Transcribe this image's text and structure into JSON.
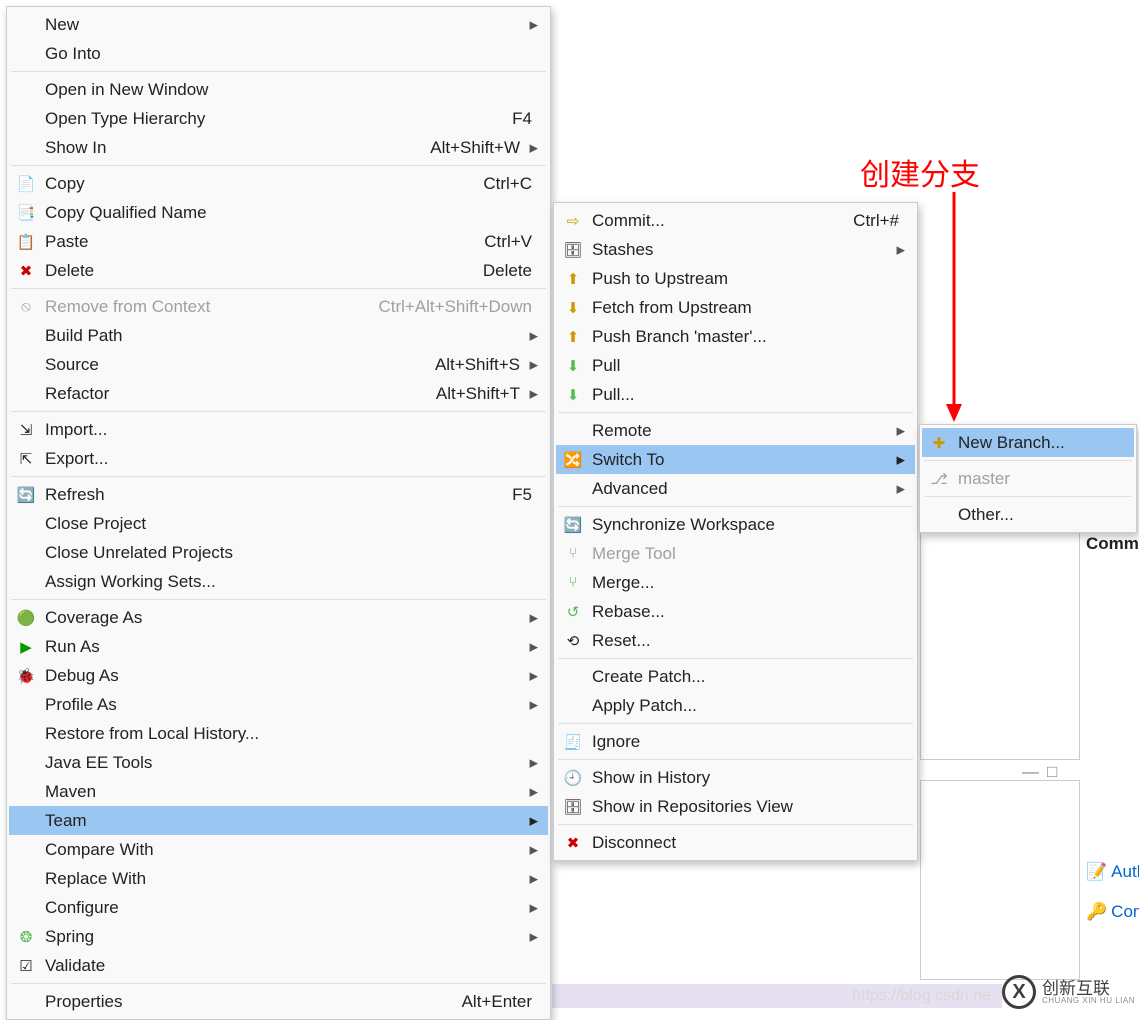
{
  "annotation": {
    "text": "创建分支"
  },
  "menu1": {
    "groups": [
      [
        {
          "icon": "",
          "label": "New",
          "accel": "",
          "arrow": true
        },
        {
          "icon": "",
          "label": "Go Into",
          "accel": "",
          "arrow": false
        }
      ],
      [
        {
          "icon": "",
          "label": "Open in New Window",
          "accel": "",
          "arrow": false
        },
        {
          "icon": "",
          "label": "Open Type Hierarchy",
          "accel": "F4",
          "arrow": false
        },
        {
          "icon": "",
          "label": "Show In",
          "accel": "Alt+Shift+W",
          "arrow": true
        }
      ],
      [
        {
          "icon": "📄",
          "iconName": "copy-icon",
          "label": "Copy",
          "accel": "Ctrl+C",
          "arrow": false
        },
        {
          "icon": "📑",
          "iconName": "copy-qualified-icon",
          "label": "Copy Qualified Name",
          "accel": "",
          "arrow": false
        },
        {
          "icon": "📋",
          "iconName": "paste-icon",
          "label": "Paste",
          "accel": "Ctrl+V",
          "arrow": false
        },
        {
          "icon": "✖",
          "iconColor": "#c00",
          "iconName": "delete-icon",
          "label": "Delete",
          "accel": "Delete",
          "arrow": false
        }
      ],
      [
        {
          "icon": "⦸",
          "iconName": "remove-context-icon",
          "label": "Remove from Context",
          "accel": "Ctrl+Alt+Shift+Down",
          "arrow": false,
          "disabled": true
        },
        {
          "icon": "",
          "label": "Build Path",
          "accel": "",
          "arrow": true
        },
        {
          "icon": "",
          "label": "Source",
          "accel": "Alt+Shift+S",
          "arrow": true
        },
        {
          "icon": "",
          "label": "Refactor",
          "accel": "Alt+Shift+T",
          "arrow": true
        }
      ],
      [
        {
          "icon": "⇲",
          "iconName": "import-icon",
          "label": "Import...",
          "accel": "",
          "arrow": false
        },
        {
          "icon": "⇱",
          "iconName": "export-icon",
          "label": "Export...",
          "accel": "",
          "arrow": false
        }
      ],
      [
        {
          "icon": "🔄",
          "iconColor": "#c90",
          "iconName": "refresh-icon",
          "label": "Refresh",
          "accel": "F5",
          "arrow": false
        },
        {
          "icon": "",
          "label": "Close Project",
          "accel": "",
          "arrow": false
        },
        {
          "icon": "",
          "label": "Close Unrelated Projects",
          "accel": "",
          "arrow": false
        },
        {
          "icon": "",
          "label": "Assign Working Sets...",
          "accel": "",
          "arrow": false
        }
      ],
      [
        {
          "icon": "🟢",
          "iconName": "coverage-icon",
          "label": "Coverage As",
          "accel": "",
          "arrow": true
        },
        {
          "icon": "▶",
          "iconColor": "#090",
          "iconName": "run-icon",
          "label": "Run As",
          "accel": "",
          "arrow": true
        },
        {
          "icon": "🐞",
          "iconName": "debug-icon",
          "label": "Debug As",
          "accel": "",
          "arrow": true
        },
        {
          "icon": "",
          "label": "Profile As",
          "accel": "",
          "arrow": true
        },
        {
          "icon": "",
          "label": "Restore from Local History...",
          "accel": "",
          "arrow": false
        },
        {
          "icon": "",
          "label": "Java EE Tools",
          "accel": "",
          "arrow": true
        },
        {
          "icon": "",
          "label": "Maven",
          "accel": "",
          "arrow": true
        },
        {
          "icon": "",
          "label": "Team",
          "accel": "",
          "arrow": true,
          "highlight": true
        },
        {
          "icon": "",
          "label": "Compare With",
          "accel": "",
          "arrow": true
        },
        {
          "icon": "",
          "label": "Replace With",
          "accel": "",
          "arrow": true
        },
        {
          "icon": "",
          "label": "Configure",
          "accel": "",
          "arrow": true
        },
        {
          "icon": "❂",
          "iconColor": "#5b5",
          "iconName": "spring-icon",
          "label": "Spring",
          "accel": "",
          "arrow": true
        },
        {
          "icon": "☑",
          "iconName": "validate-icon",
          "label": "Validate",
          "accel": "",
          "arrow": false
        }
      ],
      [
        {
          "icon": "",
          "label": "Properties",
          "accel": "Alt+Enter",
          "arrow": false
        }
      ]
    ]
  },
  "menu2": {
    "groups": [
      [
        {
          "icon": "⇨",
          "iconColor": "#c90",
          "iconName": "commit-icon",
          "label": "Commit...",
          "accel": "Ctrl+#",
          "arrow": false
        },
        {
          "icon": "🗄",
          "iconName": "stashes-icon",
          "label": "Stashes",
          "accel": "",
          "arrow": true
        },
        {
          "icon": "⬆",
          "iconColor": "#c90",
          "iconName": "push-upstream-icon",
          "label": "Push to Upstream",
          "accel": "",
          "arrow": false
        },
        {
          "icon": "⬇",
          "iconColor": "#c90",
          "iconName": "fetch-upstream-icon",
          "label": "Fetch from Upstream",
          "accel": "",
          "arrow": false
        },
        {
          "icon": "⬆",
          "iconColor": "#c90",
          "iconName": "push-branch-icon",
          "label": "Push Branch 'master'...",
          "accel": "",
          "arrow": false
        },
        {
          "icon": "⬇",
          "iconColor": "#5b5",
          "iconName": "pull-icon",
          "label": "Pull",
          "accel": "",
          "arrow": false
        },
        {
          "icon": "⬇",
          "iconColor": "#5b5",
          "iconName": "pull-opts-icon",
          "label": "Pull...",
          "accel": "",
          "arrow": false
        }
      ],
      [
        {
          "icon": "",
          "label": "Remote",
          "accel": "",
          "arrow": true
        },
        {
          "icon": "🔀",
          "iconName": "switch-to-icon",
          "label": "Switch To",
          "accel": "",
          "arrow": true,
          "highlight": true
        },
        {
          "icon": "",
          "label": "Advanced",
          "accel": "",
          "arrow": true
        }
      ],
      [
        {
          "icon": "🔄",
          "iconColor": "#c90",
          "iconName": "sync-workspace-icon",
          "label": "Synchronize Workspace",
          "accel": "",
          "arrow": false
        },
        {
          "icon": "⑂",
          "iconName": "merge-tool-icon",
          "label": "Merge Tool",
          "accel": "",
          "arrow": false,
          "disabled": true
        },
        {
          "icon": "⑂",
          "iconColor": "#5b5",
          "iconName": "merge-icon",
          "label": "Merge...",
          "accel": "",
          "arrow": false
        },
        {
          "icon": "↺",
          "iconColor": "#5b5",
          "iconName": "rebase-icon",
          "label": "Rebase...",
          "accel": "",
          "arrow": false
        },
        {
          "icon": "⟲",
          "iconName": "reset-icon",
          "label": "Reset...",
          "accel": "",
          "arrow": false
        }
      ],
      [
        {
          "icon": "",
          "label": "Create Patch...",
          "accel": "",
          "arrow": false
        },
        {
          "icon": "",
          "label": "Apply Patch...",
          "accel": "",
          "arrow": false
        }
      ],
      [
        {
          "icon": "🧾",
          "iconName": "ignore-icon",
          "label": "Ignore",
          "accel": "",
          "arrow": false
        }
      ],
      [
        {
          "icon": "🕘",
          "iconName": "history-icon",
          "label": "Show in History",
          "accel": "",
          "arrow": false
        },
        {
          "icon": "🗄",
          "iconName": "repositories-icon",
          "label": "Show in Repositories View",
          "accel": "",
          "arrow": false
        }
      ],
      [
        {
          "icon": "✖",
          "iconColor": "#c00",
          "iconName": "disconnect-icon",
          "label": "Disconnect",
          "accel": "",
          "arrow": false
        }
      ]
    ]
  },
  "menu3": {
    "groups": [
      [
        {
          "icon": "✚",
          "iconColor": "#c90",
          "iconName": "new-branch-icon",
          "label": "New Branch...",
          "accel": "",
          "arrow": false,
          "highlight": true
        }
      ],
      [
        {
          "icon": "⎇",
          "iconName": "branch-icon",
          "label": "master",
          "accel": "",
          "arrow": false,
          "disabled": true
        }
      ],
      [
        {
          "icon": "",
          "label": "Other...",
          "accel": "",
          "arrow": false
        }
      ]
    ]
  },
  "ide": {
    "panelHeading": "Comm",
    "toolbar": {
      "a": "⊞",
      "b": "⊟",
      "c": "≡",
      "d": "▾",
      "e": "≣"
    },
    "minmax": {
      "min": "—",
      "max": "□"
    },
    "author": {
      "icon": "📝",
      "label": "Auth"
    },
    "committer": {
      "icon": "🔑",
      "label": "Com"
    }
  },
  "logo": {
    "glyph": "X",
    "text": "创新互联",
    "sub": "CHUANG XIN HU LIAN"
  },
  "watermarkUrl": "https://blog.csdn.ne"
}
